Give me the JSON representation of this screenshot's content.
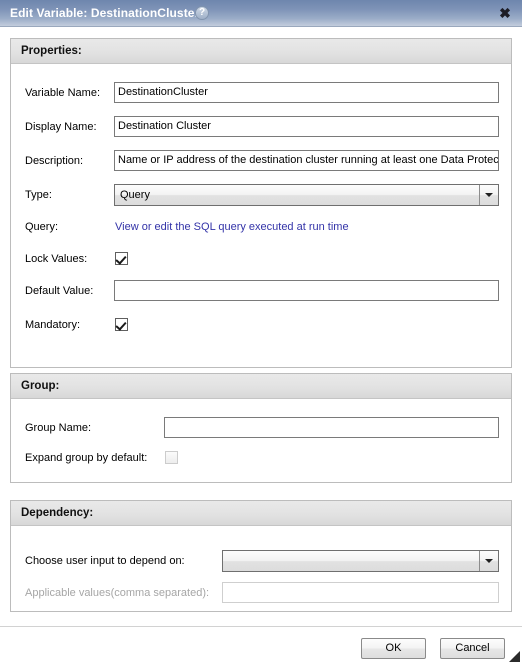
{
  "window": {
    "title": "Edit Variable: DestinationCluster",
    "help_icon": "question-mark-icon",
    "close_icon": "✖"
  },
  "properties": {
    "header": "Properties:",
    "fields": {
      "variable_name_label": "Variable Name:",
      "variable_name_value": "DestinationCluster",
      "display_name_label": "Display Name:",
      "display_name_value": "Destination Cluster",
      "description_label": "Description:",
      "description_value": "Name or IP address of the destination cluster running at least one Data Protec",
      "type_label": "Type:",
      "type_value": "Query",
      "query_label": "Query:",
      "query_link": "View or edit the SQL query executed at run time",
      "lock_values_label": "Lock Values:",
      "lock_values_checked": "checked",
      "default_value_label": "Default Value:",
      "default_value_value": "",
      "mandatory_label": "Mandatory:",
      "mandatory_checked": "checked"
    }
  },
  "group": {
    "header": "Group:",
    "group_name_label": "Group Name:",
    "group_name_value": "",
    "expand_label": "Expand group by default:",
    "expand_checked": "unchecked"
  },
  "dependency": {
    "header": "Dependency:",
    "choose_input_label": "Choose user input to depend on:",
    "choose_input_value": "",
    "applicable_values_label": "Applicable values(comma separated):",
    "applicable_values_value": ""
  },
  "footer": {
    "ok_label": "OK",
    "cancel_label": "Cancel"
  },
  "colors": {
    "titlebar_start": "#6e86ad",
    "titlebar_end": "#c3cddd",
    "link": "#3333a8",
    "panel_border": "#bcbcbc",
    "disabled_text": "#a6a6a6"
  }
}
